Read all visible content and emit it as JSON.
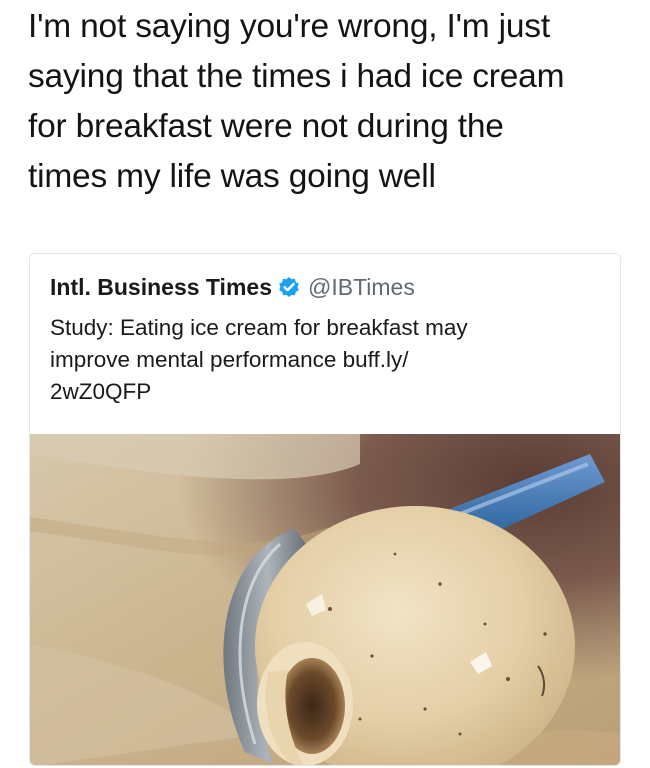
{
  "caption": {
    "text": "I'm not saying you're wrong, I'm just\nsaying that the times i had ice cream\nfor breakfast were not during the\ntimes my life was going well"
  },
  "tweet": {
    "author_name": "Intl. Business Times",
    "handle": "@IBTimes",
    "verified_icon": "verified-badge-icon",
    "text": "Study: Eating ice cream for breakfast may\nimprove mental performance buff.ly/\n2wZ0QFP",
    "image_subject": "ice-cream-scoop-photo"
  },
  "colors": {
    "verified_badge": "#1da1f2",
    "handle_text": "#5f6b74",
    "card_border": "#e3e6e8",
    "scoop_handle": "#3a6fa8",
    "ice_cream": "#e6d4b0"
  }
}
